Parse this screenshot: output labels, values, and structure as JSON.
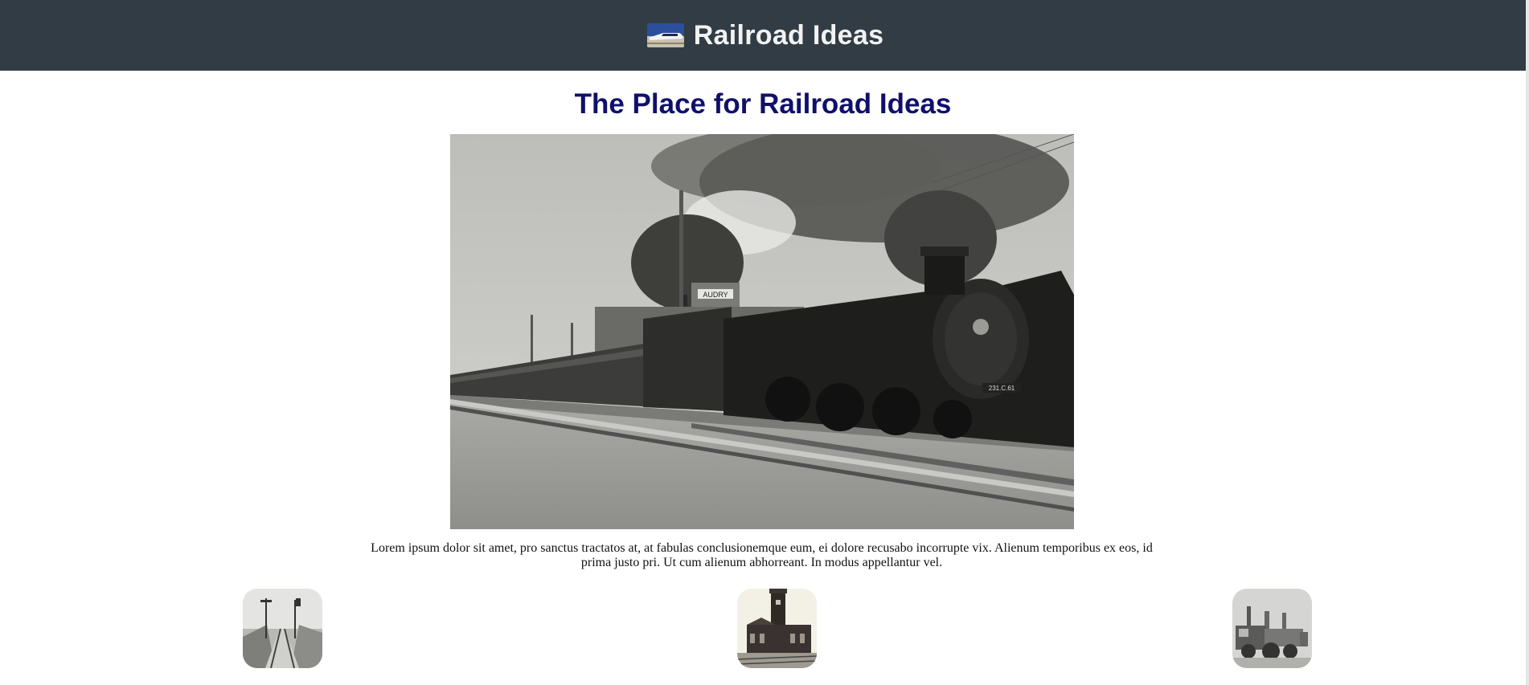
{
  "header": {
    "logo_icon": "bullet-train-photo-icon",
    "title": "Railroad Ideas",
    "background": "#323c45"
  },
  "main": {
    "heading": "The Place for Railroad Ideas",
    "heading_color": "#10106b",
    "hero_image": "steam-locomotive-at-station-photo",
    "hero_station_sign": "AUDRY",
    "hero_engine_number": "231.C.61",
    "intro": "Lorem ipsum dolor sit amet, pro sanctus tractatos at, at fabulas conclusionemque eum, ei dolore recusabo incorrupte vix. Alienum temporibus ex eos, id prima justo pri. Ut cum alienum abhorreant. In modus appellantur vel."
  },
  "gallery": [
    {
      "image": "railway-tracks-with-signals-photo"
    },
    {
      "image": "brick-station-clock-tower-photo"
    },
    {
      "image": "vintage-locomotive-photo"
    }
  ]
}
